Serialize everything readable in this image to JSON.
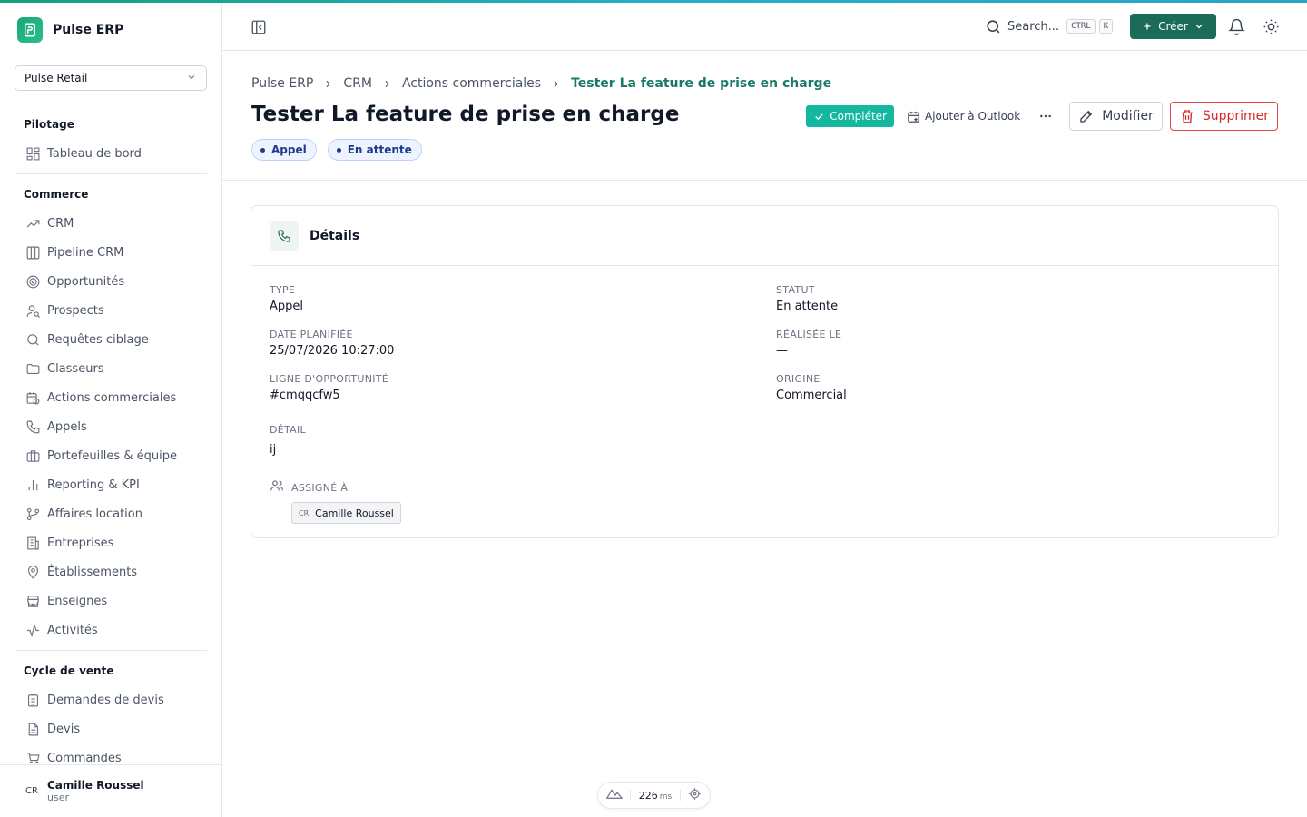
{
  "app": {
    "name": "Pulse ERP"
  },
  "org_select": {
    "value": "Pulse Retail"
  },
  "nav": {
    "sections": [
      {
        "title": "Pilotage",
        "items": [
          {
            "label": "Tableau de bord",
            "icon": "dashboard-icon"
          }
        ]
      },
      {
        "title": "Commerce",
        "items": [
          {
            "label": "CRM",
            "icon": "trend-icon"
          },
          {
            "label": "Pipeline CRM",
            "icon": "columns-icon"
          },
          {
            "label": "Opportunités",
            "icon": "target-icon"
          },
          {
            "label": "Prospects",
            "icon": "user-search-icon"
          },
          {
            "label": "Requêtes ciblage",
            "icon": "search-icon"
          },
          {
            "label": "Classeurs",
            "icon": "folder-icon"
          },
          {
            "label": "Actions commerciales",
            "icon": "calendar-clock-icon"
          },
          {
            "label": "Appels",
            "icon": "phone-icon"
          },
          {
            "label": "Portefeuilles & équipe",
            "icon": "briefcase-icon"
          },
          {
            "label": "Reporting & KPI",
            "icon": "bar-chart-icon"
          },
          {
            "label": "Affaires location",
            "icon": "branch-icon"
          },
          {
            "label": "Entreprises",
            "icon": "building-icon"
          },
          {
            "label": "Établissements",
            "icon": "map-pin-icon"
          },
          {
            "label": "Enseignes",
            "icon": "store-icon"
          },
          {
            "label": "Activités",
            "icon": "activity-icon"
          }
        ]
      },
      {
        "title": "Cycle de vente",
        "items": [
          {
            "label": "Demandes de devis",
            "icon": "clipboard-icon"
          },
          {
            "label": "Devis",
            "icon": "file-icon"
          },
          {
            "label": "Commandes",
            "icon": "cart-icon"
          }
        ]
      }
    ]
  },
  "user": {
    "initials": "CR",
    "name": "Camille Roussel",
    "role": "user"
  },
  "topbar": {
    "search_label": "Search...",
    "shortcut_keys": [
      "CTRL",
      "K"
    ],
    "create_label": "Créer"
  },
  "breadcrumb": [
    "Pulse ERP",
    "CRM",
    "Actions commerciales",
    "Tester La feature de prise en charge"
  ],
  "page": {
    "title": "Tester La feature de prise en charge",
    "badges": [
      "Appel",
      "En attente"
    ]
  },
  "actions": {
    "complete": "Compléter",
    "outlook": "Ajouter à Outlook",
    "edit": "Modifier",
    "delete": "Supprimer"
  },
  "details": {
    "title": "Détails",
    "fields": [
      {
        "label": "TYPE",
        "value": "Appel"
      },
      {
        "label": "STATUT",
        "value": "En attente"
      },
      {
        "label": "DATE PLANIFIÉE",
        "value": "25/07/2026 10:27:00"
      },
      {
        "label": "RÉALISÉE LE",
        "value": "—"
      },
      {
        "label": "LIGNE D'OPPORTUNITÉ",
        "value": "#cmqqcfw5"
      },
      {
        "label": "ORIGINE",
        "value": "Commercial"
      },
      {
        "label": "DÉTAIL",
        "value": "ij"
      }
    ],
    "assigned_label": "ASSIGNÉ À",
    "assignee": {
      "initials": "CR",
      "name": "Camille Roussel"
    }
  },
  "perf": {
    "value": "226",
    "unit": "ms"
  },
  "colors": {
    "brand": "#1b6b5b",
    "accent": "#14b8a0",
    "danger": "#dc2626",
    "badge": "#eef4ff"
  }
}
